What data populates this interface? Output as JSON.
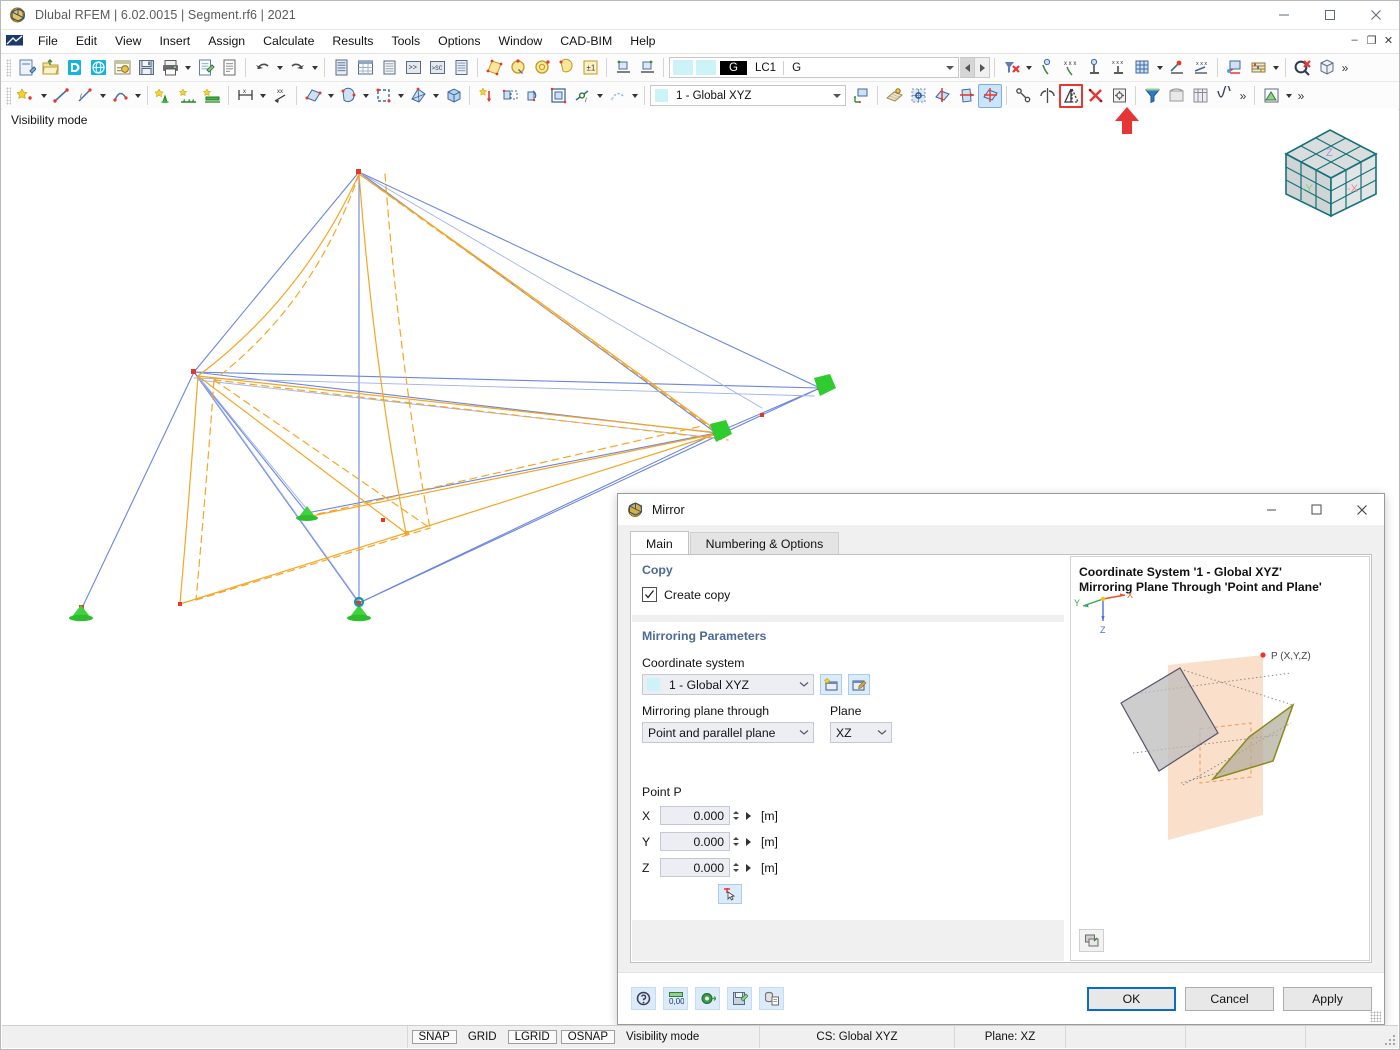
{
  "window": {
    "title": "Dlubal RFEM | 6.02.0015 | Segment.rf6 | 2021",
    "app_icon": "rfem-logo-icon",
    "minimize": "minimize-icon",
    "maximize": "maximize-icon",
    "close": "close-icon"
  },
  "menu": {
    "items": [
      {
        "label": "File"
      },
      {
        "label": "Edit"
      },
      {
        "label": "View"
      },
      {
        "label": "Insert"
      },
      {
        "label": "Assign"
      },
      {
        "label": "Calculate"
      },
      {
        "label": "Results"
      },
      {
        "label": "Tools"
      },
      {
        "label": "Options"
      },
      {
        "label": "Window"
      },
      {
        "label": "CAD-BIM"
      },
      {
        "label": "Help"
      }
    ],
    "mdi": {
      "minimize": "–",
      "restore": "❐",
      "close": "✕"
    }
  },
  "toolbar_loadcase": {
    "swatch_color": "#ccf3f7",
    "tag": "G",
    "case_id": "LC1",
    "case_name": "G",
    "prev_icon": "prev-arrow-icon",
    "next_icon": "next-arrow-icon"
  },
  "toolbar_cs": {
    "value": "1 - Global XYZ",
    "swatch_color": "#ccf3f7"
  },
  "toolbar_icons_row1": [
    "new-model-icon",
    "open-folder-icon",
    "dlubal-center-icon",
    "dlubal-globe-icon",
    "model-info-icon",
    "save-icon",
    "print-icon",
    "printout-report-icon",
    "document-icon",
    "undo-icon",
    "redo-icon",
    "navigator-icon",
    "table-icon",
    "table-list-icon",
    "console-icon",
    "script-icon",
    "panel-icon",
    "render-surface-icon",
    "render-node-icon",
    "render-global-icon",
    "render-solid-icon",
    "render-box-icon",
    "snap-point-icon",
    "snap-line-icon"
  ],
  "toolbar_icons_row2": [
    "new-node-icon",
    "new-line-icon",
    "new-arc-icon",
    "new-polyline-icon",
    "nodal-support-icon",
    "line-support-icon",
    "member-support-icon",
    "dimension-x-icon",
    "dimension-xx-icon",
    "new-surface-icon",
    "new-solid-icon",
    "new-opening-icon",
    "new-mesh-icon",
    "new-volume-icon",
    "load-icon",
    "move-icon",
    "rotate-icon",
    "scale-icon",
    "member-hinge-icon",
    "misc-icon"
  ],
  "toolbar_icons_row1_right": [
    "delete-x-icon",
    "node-single-icon",
    "node-xxx-icon",
    "select-node-icon",
    "select-nodes-xxx-icon",
    "grid-solid-icon",
    "section-cut-icon",
    "section-xxx-icon",
    "view-render-icon",
    "abacus-icon",
    "clear-selection-icon",
    "bounding-box-icon"
  ],
  "toolbar_icons_row2_right": [
    "ucs-origin-icon",
    "work-plane-icon",
    "grid-snap-icon",
    "plane-xy-icon",
    "plane-yz-icon",
    "plane-xz-icon",
    "chain-icon",
    "symmetry-icon",
    "mirror-icon",
    "delete-cross-icon",
    "settings-box-icon",
    "filter-icon",
    "clip-icon",
    "table-view-icon",
    "curve-icon",
    "results-chart-icon"
  ],
  "viewport": {
    "visibility_mode_label": "Visibility mode",
    "nav_cube": {
      "axis_x": "-X",
      "axis_y": "-Y",
      "axis_z": "Z",
      "face_color": "#d9dddd",
      "edge_color": "#15727a"
    },
    "model": {
      "member_color": "#6b86de",
      "surface_color": "#f5a623",
      "node_color": "#e8362a",
      "support_color": "#27b327"
    }
  },
  "dialog": {
    "title": "Mirror",
    "icon": "mirror-dialog-icon",
    "minimize": "minimize-icon",
    "maximize": "maximize-icon",
    "close": "close-icon",
    "tabs": [
      {
        "label": "Main",
        "selected": true
      },
      {
        "label": "Numbering & Options",
        "selected": false
      }
    ],
    "copy_group": {
      "title": "Copy",
      "create_copy_label": "Create copy",
      "create_copy_checked": true
    },
    "mirroring_group": {
      "title": "Mirroring Parameters",
      "coordinate_system_label": "Coordinate system",
      "coordinate_system_value": "1 - Global XYZ",
      "new_cs_icon": "new-coordinate-system-icon",
      "edit_cs_icon": "edit-coordinate-system-icon",
      "plane_through_label": "Mirroring plane through",
      "plane_through_value": "Point and parallel plane",
      "plane_label": "Plane",
      "plane_value": "XZ",
      "point_label": "Point P",
      "coords": [
        {
          "axis": "X",
          "value": "0.000",
          "unit": "[m]"
        },
        {
          "axis": "Y",
          "value": "0.000",
          "unit": "[m]"
        },
        {
          "axis": "Z",
          "value": "0.000",
          "unit": "[m]"
        }
      ],
      "pick_point_icon": "pick-point-icon"
    },
    "preview": {
      "line1": "Coordinate System '1 - Global XYZ'",
      "line2": "Mirroring Plane Through 'Point and Plane'",
      "axis_x": "X",
      "axis_y": "Y",
      "axis_z": "Z",
      "point_label": "P (X,Y,Z)",
      "settings_icon": "preview-settings-icon",
      "plane_color": "#fae0cb",
      "original_color": "#6c6c7a",
      "mirrored_color": "#8a8a1e"
    },
    "footer_icons": [
      "help-icon",
      "decimal-places-icon",
      "units-icon",
      "save-defaults-icon",
      "details-icon"
    ],
    "buttons": [
      {
        "label": "OK",
        "primary": true
      },
      {
        "label": "Cancel",
        "primary": false
      },
      {
        "label": "Apply",
        "primary": false
      }
    ]
  },
  "statusbar": {
    "toggles": [
      {
        "label": "SNAP",
        "on": true
      },
      {
        "label": "GRID",
        "on": false
      },
      {
        "label": "LGRID",
        "on": true
      },
      {
        "label": "OSNAP",
        "on": true
      }
    ],
    "mode": "Visibility mode",
    "cs": "CS: Global XYZ",
    "plane": "Plane: XZ"
  },
  "annotation": {
    "highlight_color": "#e53535",
    "arrow_name": "red-callout-arrow"
  }
}
